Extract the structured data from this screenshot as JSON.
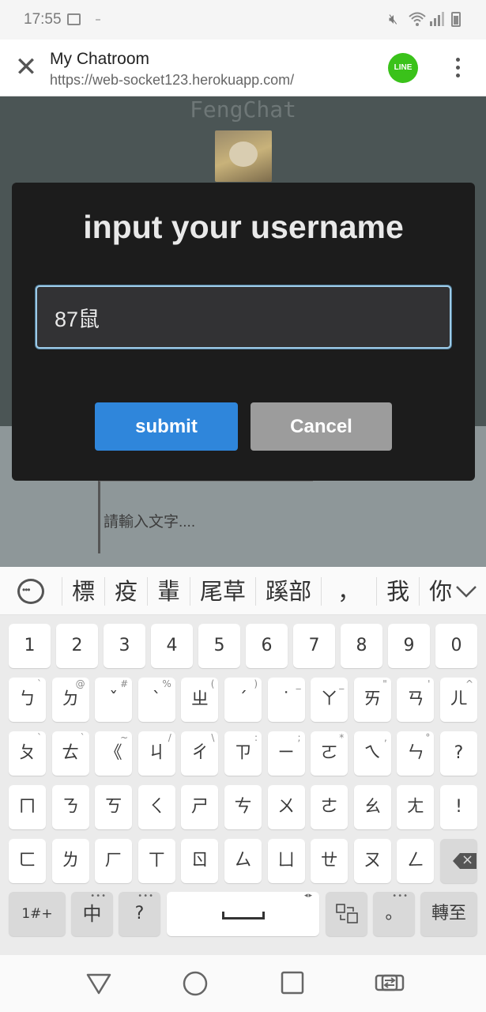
{
  "status_bar": {
    "time": "17:55"
  },
  "browser": {
    "title": "My Chatroom",
    "url": "https://web-socket123.herokuapp.com/",
    "line_logo_text": "LINE"
  },
  "page": {
    "brand": "FengChat",
    "message_placeholder": "請輸入文字...."
  },
  "dialog": {
    "heading": "input your username",
    "username_value": "87鼠",
    "submit_label": "submit",
    "cancel_label": "Cancel"
  },
  "candidates": [
    "標",
    "疫",
    "輩",
    "尾草",
    "蹊部",
    "，",
    "我",
    "你"
  ],
  "keyboard": {
    "row1": [
      "1",
      "2",
      "3",
      "4",
      "5",
      "6",
      "7",
      "8",
      "9",
      "0"
    ],
    "row2": [
      {
        "m": "ㄅ",
        "s": "`"
      },
      {
        "m": "ㄉ",
        "s": "@"
      },
      {
        "m": "ˇ",
        "s": "#"
      },
      {
        "m": "ˋ",
        "s": "%"
      },
      {
        "m": "ㄓ",
        "s": "("
      },
      {
        "m": "ˊ",
        "s": ")"
      },
      {
        "m": "˙",
        "s": "_"
      },
      {
        "m": "ㄚ",
        "s": "_"
      },
      {
        "m": "ㄞ",
        "s": "\""
      },
      {
        "m": "ㄢ",
        "s": "'"
      },
      {
        "m": "ㄦ",
        "s": "^"
      }
    ],
    "row3": [
      {
        "m": "ㄆ",
        "s": "`"
      },
      {
        "m": "ㄊ",
        "s": "`"
      },
      {
        "m": "《",
        "s": "~"
      },
      {
        "m": "ㄐ",
        "s": "/"
      },
      {
        "m": "ㄔ",
        "s": "\\"
      },
      {
        "m": "ㄗ",
        "s": ":"
      },
      {
        "m": "ㄧ",
        "s": ";"
      },
      {
        "m": "ㄛ",
        "s": "*"
      },
      {
        "m": "ㄟ",
        "s": ","
      },
      {
        "m": "ㄣ",
        "s": "°"
      },
      {
        "m": "?",
        "s": ""
      }
    ],
    "row4": [
      "ㄇ",
      "ㄋ",
      "ㄎ",
      "ㄑ",
      "ㄕ",
      "ㄘ",
      "ㄨ",
      "ㄜ",
      "ㄠ",
      "ㄤ",
      "!"
    ],
    "row5": [
      "ㄈ",
      "ㄌ",
      "ㄏ",
      "ㄒ",
      "ㄖ",
      "ㄙ",
      "ㄩ",
      "ㄝ",
      "ㄡ",
      "ㄥ"
    ],
    "symbols_label": "1#+",
    "lang_label": "中",
    "question_label": "?",
    "period_label": "。",
    "transfer_label": "轉至"
  }
}
